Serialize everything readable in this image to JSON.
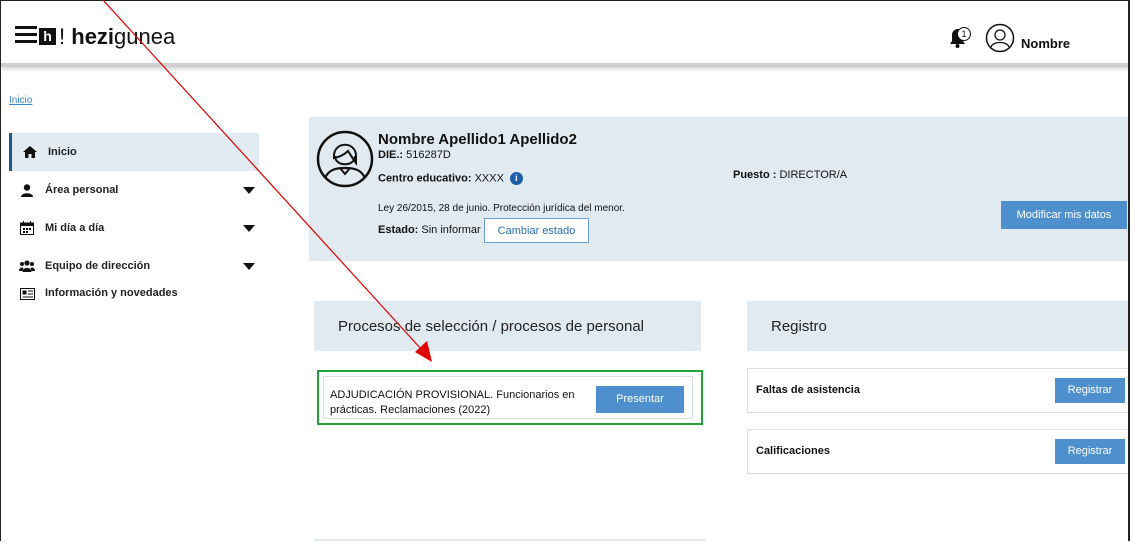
{
  "header": {
    "logo_mark": "h",
    "logo_prefix": "!",
    "logo_bold": "hezi",
    "logo_rest": "gunea",
    "notification_count": "1",
    "user_name": "Nombre"
  },
  "breadcrumb": "Inicio",
  "sidebar": {
    "items": [
      {
        "label": "Inicio",
        "icon": "home-icon"
      },
      {
        "label": "Área personal",
        "icon": "user-icon"
      },
      {
        "label": "Mi día a día",
        "icon": "calendar-icon"
      },
      {
        "label": "Equipo de dirección",
        "icon": "group-icon"
      },
      {
        "label": "Información y novedades",
        "icon": "news-icon"
      }
    ]
  },
  "profile": {
    "name": "Nombre Apellido1 Apellido2",
    "die_label": "DIE.:",
    "die_value": "516287D",
    "centro_label": "Centro educativo:",
    "centro_value": "XXXX",
    "info_glyph": "i",
    "puesto_label": "Puesto :",
    "puesto_value": "DIRECTOR/A",
    "ley": "Ley 26/2015, 28 de junio. Protección jurídica del menor.",
    "estado_label": "Estado:",
    "estado_value": "Sin informar",
    "cambiar_estado": "Cambiar estado",
    "modificar": "Modificar mis datos"
  },
  "procesos": {
    "title": "Procesos de selección / procesos de personal",
    "item_text": "ADJUDICACIÓN PROVISIONAL. Funcionarios en prácticas. Reclamaciones (2022)",
    "item_button": "Presentar"
  },
  "registro": {
    "title": "Registro",
    "rows": [
      {
        "label": "Faltas de asistencia",
        "button": "Registrar"
      },
      {
        "label": "Calificaciones",
        "button": "Registrar"
      }
    ]
  },
  "annotation": {
    "arrow_color": "#e00000",
    "highlight_color": "#1fa33a"
  }
}
